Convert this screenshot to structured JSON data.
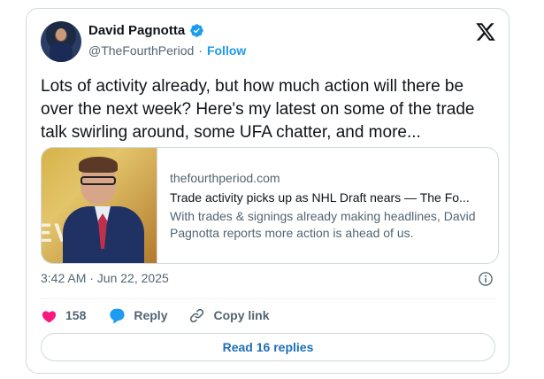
{
  "author": {
    "name": "David Pagnotta",
    "handle": "@TheFourthPeriod",
    "separator": "·",
    "follow_label": "Follow",
    "verified_color": "#1d9bf0"
  },
  "tweet": {
    "text": "Lots of activity already, but how much action will there be over the next week? Here's my latest on some of the trade talk swirling around, some UFA chatter, and more..."
  },
  "link_card": {
    "domain": "thefourthperiod.com",
    "title": "Trade activity picks up as NHL Draft nears — The Fo...",
    "description": "With trades & signings already making headlines, David Pagnotta reports more action is ahead of us."
  },
  "meta": {
    "timestamp": "3:42 AM · Jun 22, 2025"
  },
  "actions": {
    "like_count": "158",
    "reply_label": "Reply",
    "copy_link_label": "Copy link"
  },
  "replies_button": {
    "label": "Read 16 replies"
  },
  "icons": {
    "logo": "x-logo-icon",
    "verified": "verified-badge-icon",
    "info": "info-icon",
    "like": "heart-icon",
    "reply": "reply-bubble-icon",
    "copy": "link-icon"
  },
  "colors": {
    "accent": "#1d9bf0",
    "like": "#f91880",
    "text": "#0f1419",
    "muted": "#536471",
    "border": "#cfd9de"
  }
}
